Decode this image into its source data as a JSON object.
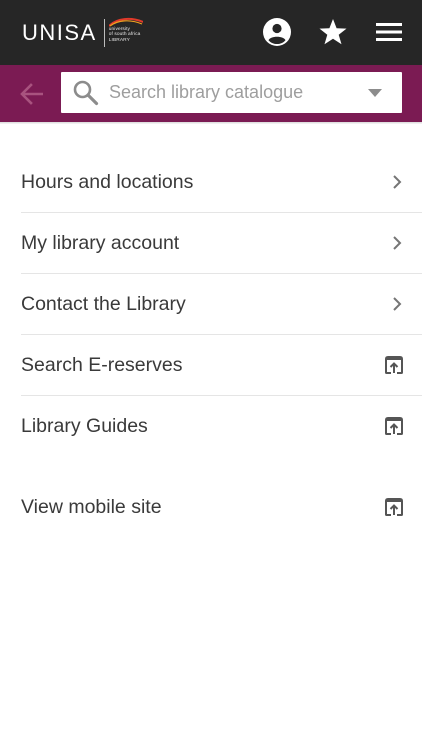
{
  "header": {
    "logo_word": "UNISA",
    "logo_lines": [
      "university",
      "of south africa",
      "LIBRARY"
    ],
    "icons": [
      "account-circle-icon",
      "star-icon",
      "hamburger-menu-icon"
    ]
  },
  "search": {
    "placeholder": "Search library catalogue",
    "value": ""
  },
  "colors": {
    "topbar": "#262626",
    "accent": "#7b1b53",
    "text": "#3a3a3a"
  },
  "menu": {
    "items": [
      {
        "label": "Hours and locations",
        "icon": "chevron-right-icon"
      },
      {
        "label": "My library account",
        "icon": "chevron-right-icon"
      },
      {
        "label": "Contact the Library",
        "icon": "chevron-right-icon"
      },
      {
        "label": "Search E-reserves",
        "icon": "open-external-icon"
      },
      {
        "label": "Library Guides",
        "icon": "open-external-icon"
      }
    ],
    "footer_item": {
      "label": "View mobile site",
      "icon": "open-external-icon"
    }
  }
}
